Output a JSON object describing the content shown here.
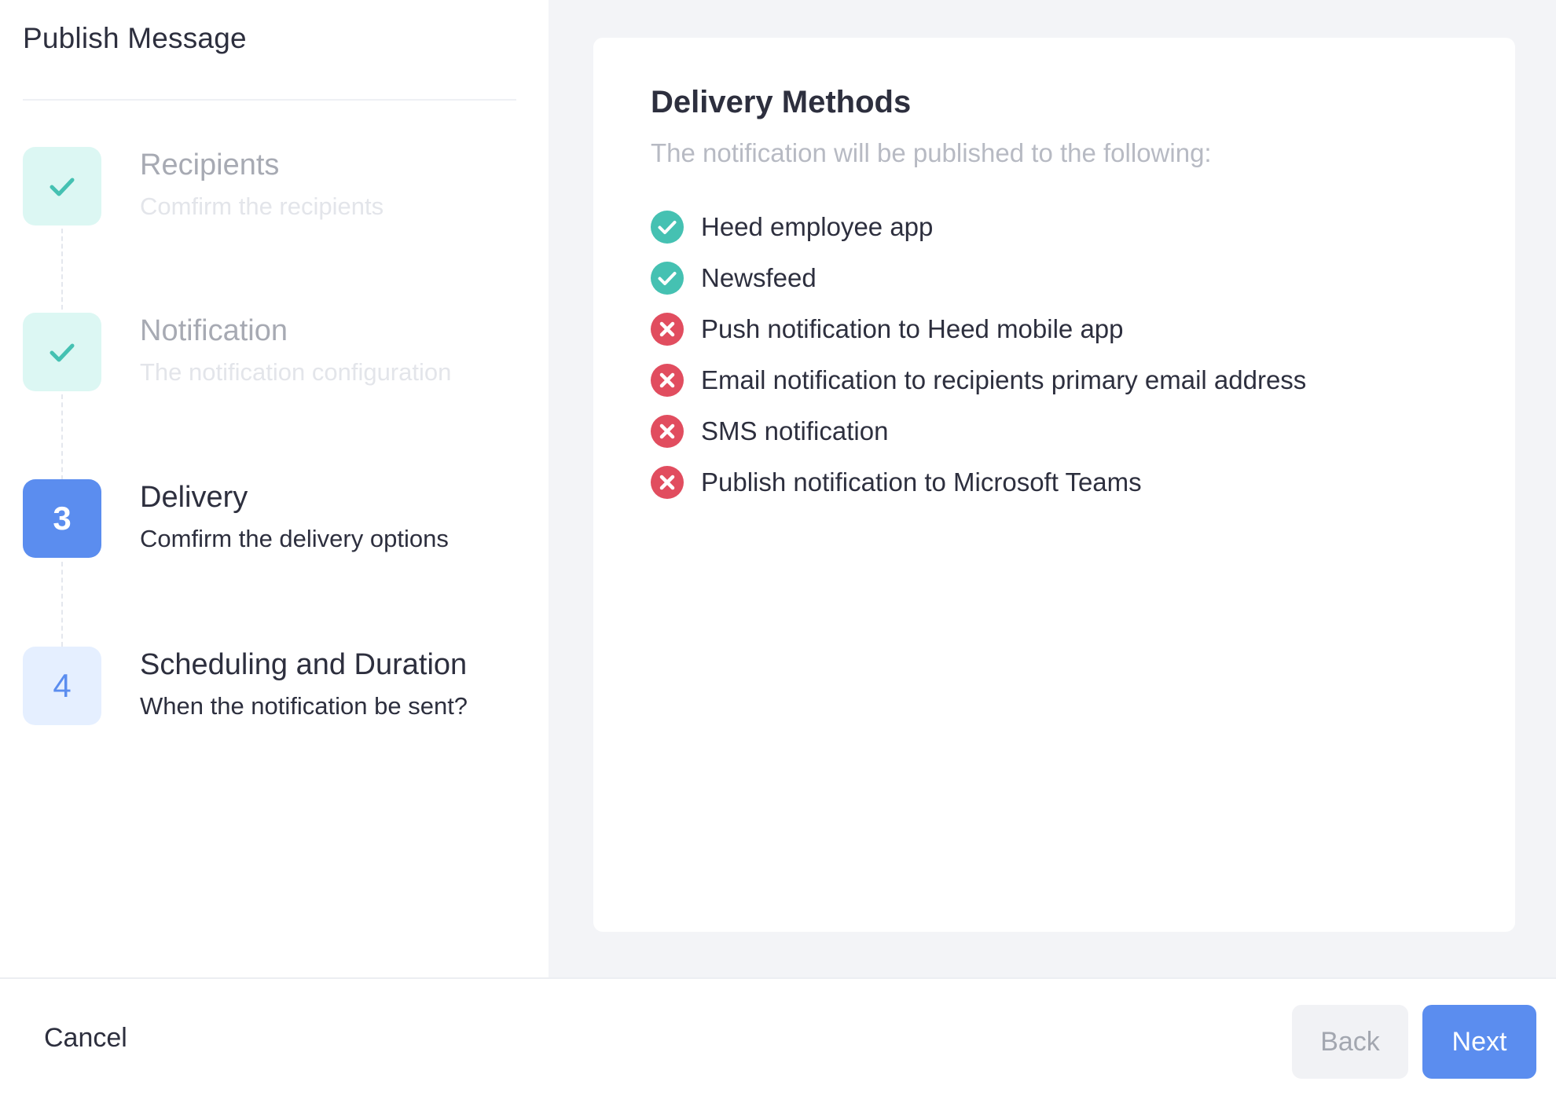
{
  "sidebar": {
    "title": "Publish Message",
    "steps": [
      {
        "badge": "",
        "icon": "check-icon",
        "state": "done",
        "title": "Recipients",
        "subtitle": "Comfirm the recipients"
      },
      {
        "badge": "",
        "icon": "check-icon",
        "state": "done",
        "title": "Notification",
        "subtitle": "The notification configuration"
      },
      {
        "badge": "3",
        "state": "active",
        "title": "Delivery",
        "subtitle": "Comfirm the delivery options"
      },
      {
        "badge": "4",
        "state": "pending",
        "title": "Scheduling and Duration",
        "subtitle": "When the notification be sent?"
      }
    ]
  },
  "main": {
    "title": "Delivery Methods",
    "subtitle": "The notification will be published to the following:",
    "methods": [
      {
        "label": "Heed employee app",
        "enabled": true,
        "icon": "check-circle-icon"
      },
      {
        "label": "Newsfeed",
        "enabled": true,
        "icon": "check-circle-icon"
      },
      {
        "label": "Push notification to Heed mobile app",
        "enabled": false,
        "icon": "x-circle-icon"
      },
      {
        "label": "Email notification to recipients primary email address",
        "enabled": false,
        "icon": "x-circle-icon"
      },
      {
        "label": "SMS notification",
        "enabled": false,
        "icon": "x-circle-icon"
      },
      {
        "label": "Publish notification to Microsoft Teams",
        "enabled": false,
        "icon": "x-circle-icon"
      }
    ]
  },
  "footer": {
    "cancel_label": "Cancel",
    "back_label": "Back",
    "next_label": "Next"
  },
  "colors": {
    "accent": "#5b8def",
    "success": "#45c1b2",
    "error": "#e14d5f",
    "done_badge_bg": "#dcf7f3"
  }
}
